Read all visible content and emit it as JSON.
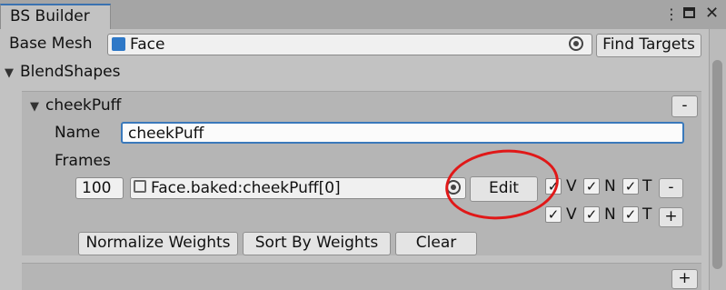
{
  "window": {
    "tab_title": "BS Builder",
    "menu_icon": "kebab-menu-icon",
    "maximize_icon": "maximize-icon",
    "close_icon": "close-icon"
  },
  "base_mesh": {
    "label": "Base Mesh",
    "value": "Face",
    "find_targets_label": "Find Targets"
  },
  "blendshapes": {
    "label": "BlendShapes",
    "items": [
      {
        "header": "cheekPuff",
        "remove_label": "-",
        "name_label": "Name",
        "name_value": "cheekPuff",
        "frames_label": "Frames",
        "frames": [
          {
            "weight": "100",
            "mesh": "Face.baked:cheekPuff[0]",
            "edit_label": "Edit",
            "flags": [
              {
                "label": "V",
                "checked": true
              },
              {
                "label": "N",
                "checked": true
              },
              {
                "label": "T",
                "checked": true
              }
            ],
            "remove_label": "-"
          }
        ],
        "new_frame_flags": [
          {
            "label": "V",
            "checked": true
          },
          {
            "label": "N",
            "checked": true
          },
          {
            "label": "T",
            "checked": true
          }
        ],
        "add_frame_label": "+",
        "actions": [
          "Normalize Weights",
          "Sort By Weights",
          "Clear"
        ]
      }
    ],
    "add_label": "+"
  },
  "annotation": {
    "color": "#e01818"
  }
}
